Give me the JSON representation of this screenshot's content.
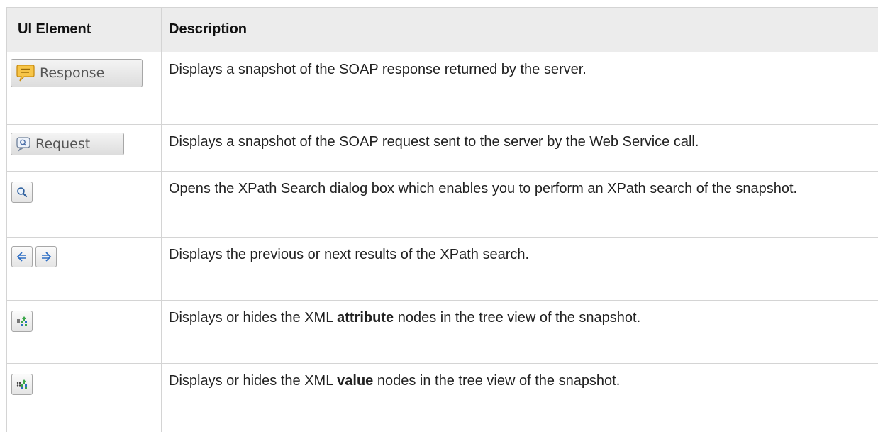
{
  "table": {
    "headers": {
      "ui_element": "UI Element",
      "description": "Description"
    },
    "rows": [
      {
        "icon": "response-speech-bubble-icon",
        "button_label": "Response",
        "description": "Displays a snapshot of the SOAP response returned by the server."
      },
      {
        "icon": "request-speech-bubble-icon",
        "button_label": "Request",
        "description": "Displays a snapshot of the SOAP request sent to the server by the Web Service call."
      },
      {
        "icon": "magnifier-icon",
        "description": "Opens the XPath Search dialog box which enables you to perform an XPath search of the snapshot."
      },
      {
        "icons": [
          "arrow-left-icon",
          "arrow-right-icon"
        ],
        "description": "Displays the previous or next results of the XPath search."
      },
      {
        "icon": "attribute-nodes-icon",
        "description_before": "Displays or hides the XML ",
        "description_bold": "attribute",
        "description_after": " nodes in the tree view of the snapshot."
      },
      {
        "icon": "value-nodes-icon",
        "description_before": "Displays or hides the XML ",
        "description_bold": "value",
        "description_after": " nodes in the tree view of the snapshot."
      }
    ]
  },
  "colors": {
    "header_background": "#ececec",
    "border": "#d4d4d4",
    "bubble_yellow": "#f2b632",
    "arrow_blue": "#3a7bd5",
    "node_green": "#3aa64a"
  }
}
